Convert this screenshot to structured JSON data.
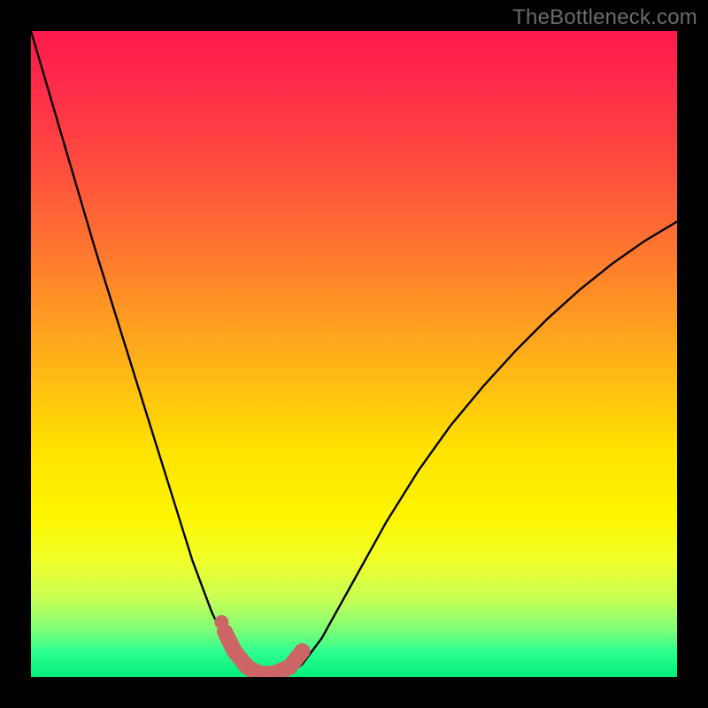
{
  "attribution": "TheBottleneck.com",
  "colors": {
    "black": "#000000",
    "salmon": "#cc6666",
    "curve": "#000000"
  },
  "chart_data": {
    "type": "line",
    "title": "",
    "xlabel": "",
    "ylabel": "",
    "xlim": [
      0,
      1
    ],
    "ylim": [
      0,
      1
    ],
    "series": [
      {
        "name": "left-branch",
        "x": [
          0.0,
          0.05,
          0.1,
          0.15,
          0.2,
          0.25,
          0.28,
          0.3,
          0.32,
          0.335,
          0.35
        ],
        "y": [
          1.0,
          0.83,
          0.66,
          0.5,
          0.34,
          0.18,
          0.1,
          0.06,
          0.03,
          0.015,
          0.005
        ]
      },
      {
        "name": "right-branch",
        "x": [
          0.4,
          0.42,
          0.45,
          0.5,
          0.55,
          0.6,
          0.65,
          0.7,
          0.75,
          0.8,
          0.85,
          0.9,
          0.95,
          1.0
        ],
        "y": [
          0.005,
          0.02,
          0.06,
          0.15,
          0.24,
          0.32,
          0.39,
          0.45,
          0.505,
          0.555,
          0.6,
          0.64,
          0.675,
          0.705
        ]
      },
      {
        "name": "salmon-overlay",
        "x": [
          0.3,
          0.315,
          0.335,
          0.355,
          0.375,
          0.4,
          0.42
        ],
        "y": [
          0.07,
          0.04,
          0.015,
          0.005,
          0.005,
          0.015,
          0.04
        ]
      }
    ],
    "markers": [
      {
        "name": "salmon-dot",
        "x": 0.295,
        "y": 0.085
      }
    ]
  }
}
